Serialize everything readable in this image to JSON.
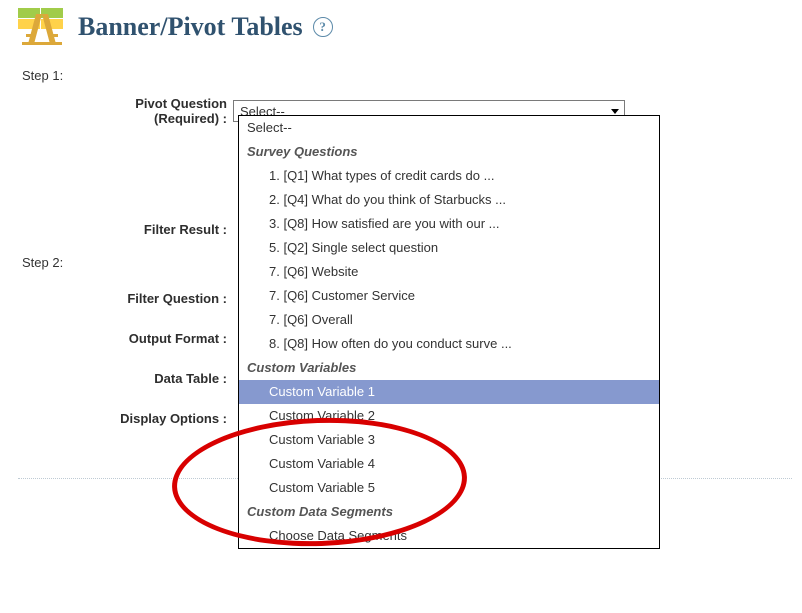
{
  "header": {
    "title": "Banner/Pivot Tables",
    "help_symbol": "?"
  },
  "steps": {
    "step1": "Step 1:",
    "step2": "Step 2:"
  },
  "labels": {
    "pivot_line1": "Pivot Question",
    "pivot_line2": "(Required) :",
    "filter_result": "Filter Result :",
    "filter_question": "Filter Question :",
    "output_format": "Output Format :",
    "data_table": "Data Table :",
    "display_options": "Display Options :"
  },
  "select": {
    "display": "Select--"
  },
  "dropdown": {
    "top": "Select--",
    "groups": [
      {
        "title": "Survey Questions",
        "items": [
          "1. [Q1] What types of credit cards do ...",
          "2. [Q4] What do you think of Starbucks ...",
          "3. [Q8] How satisfied are you with our ...",
          "5. [Q2] Single select question",
          "7. [Q6] Website",
          "7. [Q6] Customer Service",
          "7. [Q6] Overall",
          "8. [Q8] How often do you conduct surve ..."
        ]
      },
      {
        "title": "Custom Variables",
        "items": [
          "Custom Variable 1",
          "Custom Variable 2",
          "Custom Variable 3",
          "Custom Variable 4",
          "Custom Variable 5"
        ],
        "highlight_index": 0
      },
      {
        "title": "Custom Data Segments",
        "items": [
          "Choose Data Segments"
        ]
      }
    ]
  }
}
